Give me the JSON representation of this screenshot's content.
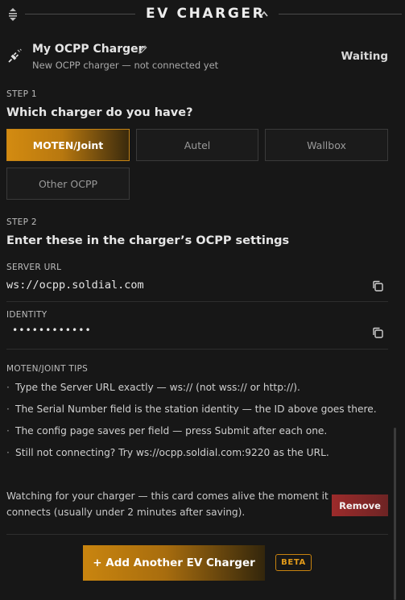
{
  "header": {
    "title": "EV CHARGER",
    "drag_icon": "drag-handle-icon",
    "collapse_icon": "chevron-up-icon"
  },
  "charger": {
    "name": "My OCPP Charger",
    "subtitle": "New OCPP charger — not connected yet",
    "status": "Waiting",
    "icon": "plug-icon",
    "edit_icon": "pencil-icon"
  },
  "step1": {
    "label": "STEP 1",
    "heading": "Which charger do you have?",
    "options": [
      "MOTEN/Joint",
      "Autel",
      "Wallbox",
      "Other OCPP"
    ],
    "selected": "MOTEN/Joint"
  },
  "step2": {
    "label": "STEP 2",
    "heading": "Enter these in the charger’s OCPP settings",
    "server_url_label": "SERVER URL",
    "server_url": "ws://ocpp.soldial.com",
    "identity_label": "IDENTITY",
    "identity": "••••••••••••",
    "copy_icon": "copy-icon"
  },
  "tips": {
    "label": "MOTEN/JOINT TIPS",
    "bullet": "·",
    "items": [
      "Type the Server URL exactly — ws:// (not wss:// or http://).",
      "The Serial Number field is the station identity — the ID above goes there.",
      "The config page saves per field — press Submit after each one.",
      "Still not connecting? Try ws://ocpp.soldial.com:9220 as the URL."
    ]
  },
  "watching": {
    "text": "Watching for your charger — this card comes alive the moment it connects (usually under 2 minutes after saving).",
    "remove_label": "Remove"
  },
  "footer": {
    "add_label": "+ Add Another EV Charger",
    "beta_label": "BETA"
  },
  "colors": {
    "background": "#171717",
    "accent": "#c9850f",
    "danger": "#9c2b2b"
  }
}
